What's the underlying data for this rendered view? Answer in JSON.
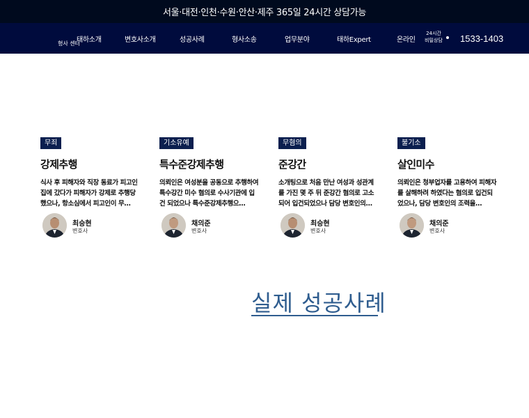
{
  "topbar": {
    "text": "서울·대전·인천·수원·안산·제주 365일 24시간 상담가능"
  },
  "nav": {
    "items": [
      "태하소개",
      "변호사소개",
      "성공사례",
      "형사소송",
      "업무분야",
      "태하Expert",
      "온라인"
    ],
    "sub_label": "형사 센터",
    "consult_line1": "24시간",
    "consult_line2": "비밀상담",
    "phone": "1533-1403"
  },
  "cards": [
    {
      "badge": "무죄",
      "title": "강제추행",
      "text": "식사 후 피해자와 직장 동료가 피고인 집에 갔다가 피해자가 강제로 추행당했으나, 항소심에서 피고인이 무…",
      "lawyer": "최승현",
      "role": "변호사"
    },
    {
      "badge": "기소유예",
      "title": "특수준강제추행",
      "text": "의뢰인은 여성분을 공동으로 추행하여 특수강간 미수 혐의로 수사기관에 입건 되었으나 특수준강제추행으…",
      "lawyer": "채의준",
      "role": "변호사"
    },
    {
      "badge": "무혐의",
      "title": "준강간",
      "text": "소개팅으로 처음 만난 여성과 성관계를 가진 몇 주 뒤 준강간 혐의로 고소되어 입건되었으나 담당 변호인의…",
      "lawyer": "최승현",
      "role": "변호사"
    },
    {
      "badge": "불기소",
      "title": "살인미수",
      "text": "의뢰인은 청부업자를 고용하여 피해자를 살해하려 하였다는 혐의로 입건되었으나, 담당 변호인의 조력을…",
      "lawyer": "채의준",
      "role": "변호사"
    }
  ],
  "section": {
    "title": "실제 성공사례"
  },
  "colors": {
    "topbar": "#000a1e",
    "nav": "#000b3d",
    "badge": "#0b1f4f",
    "accent": "#2f5d8f"
  }
}
